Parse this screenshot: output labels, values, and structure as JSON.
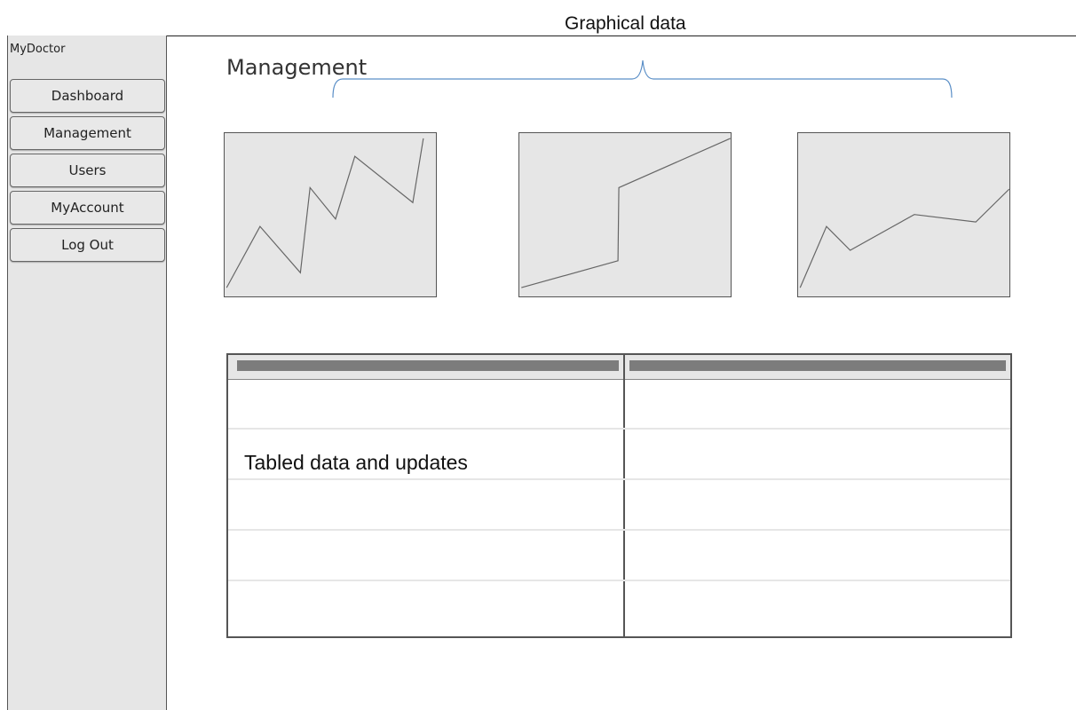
{
  "annotations": {
    "graphical": "Graphical data",
    "tabled": "Tabled data and updates"
  },
  "app": {
    "brand": "MyDoctor"
  },
  "sidebar": {
    "items": [
      {
        "label": "Dashboard"
      },
      {
        "label": "Management"
      },
      {
        "label": "Users"
      },
      {
        "label": "MyAccount"
      },
      {
        "label": "Log Out"
      }
    ]
  },
  "main": {
    "title": "Management"
  },
  "colors": {
    "panel_bg": "#e6e6e6",
    "border": "#555555",
    "line": "#666666",
    "brace": "#5b8fc7"
  },
  "charts": [
    {
      "type": "line",
      "values": [
        0,
        41,
        10,
        67,
        46,
        88,
        57,
        100
      ]
    },
    {
      "type": "line",
      "values": [
        0,
        18,
        67,
        100
      ]
    },
    {
      "type": "line",
      "values": [
        0,
        41,
        25,
        49,
        44,
        66
      ]
    }
  ],
  "table": {
    "columns": [
      "",
      ""
    ],
    "rows": [
      [
        "",
        ""
      ],
      [
        "",
        ""
      ],
      [
        "",
        ""
      ],
      [
        "",
        ""
      ],
      [
        "",
        ""
      ]
    ]
  }
}
